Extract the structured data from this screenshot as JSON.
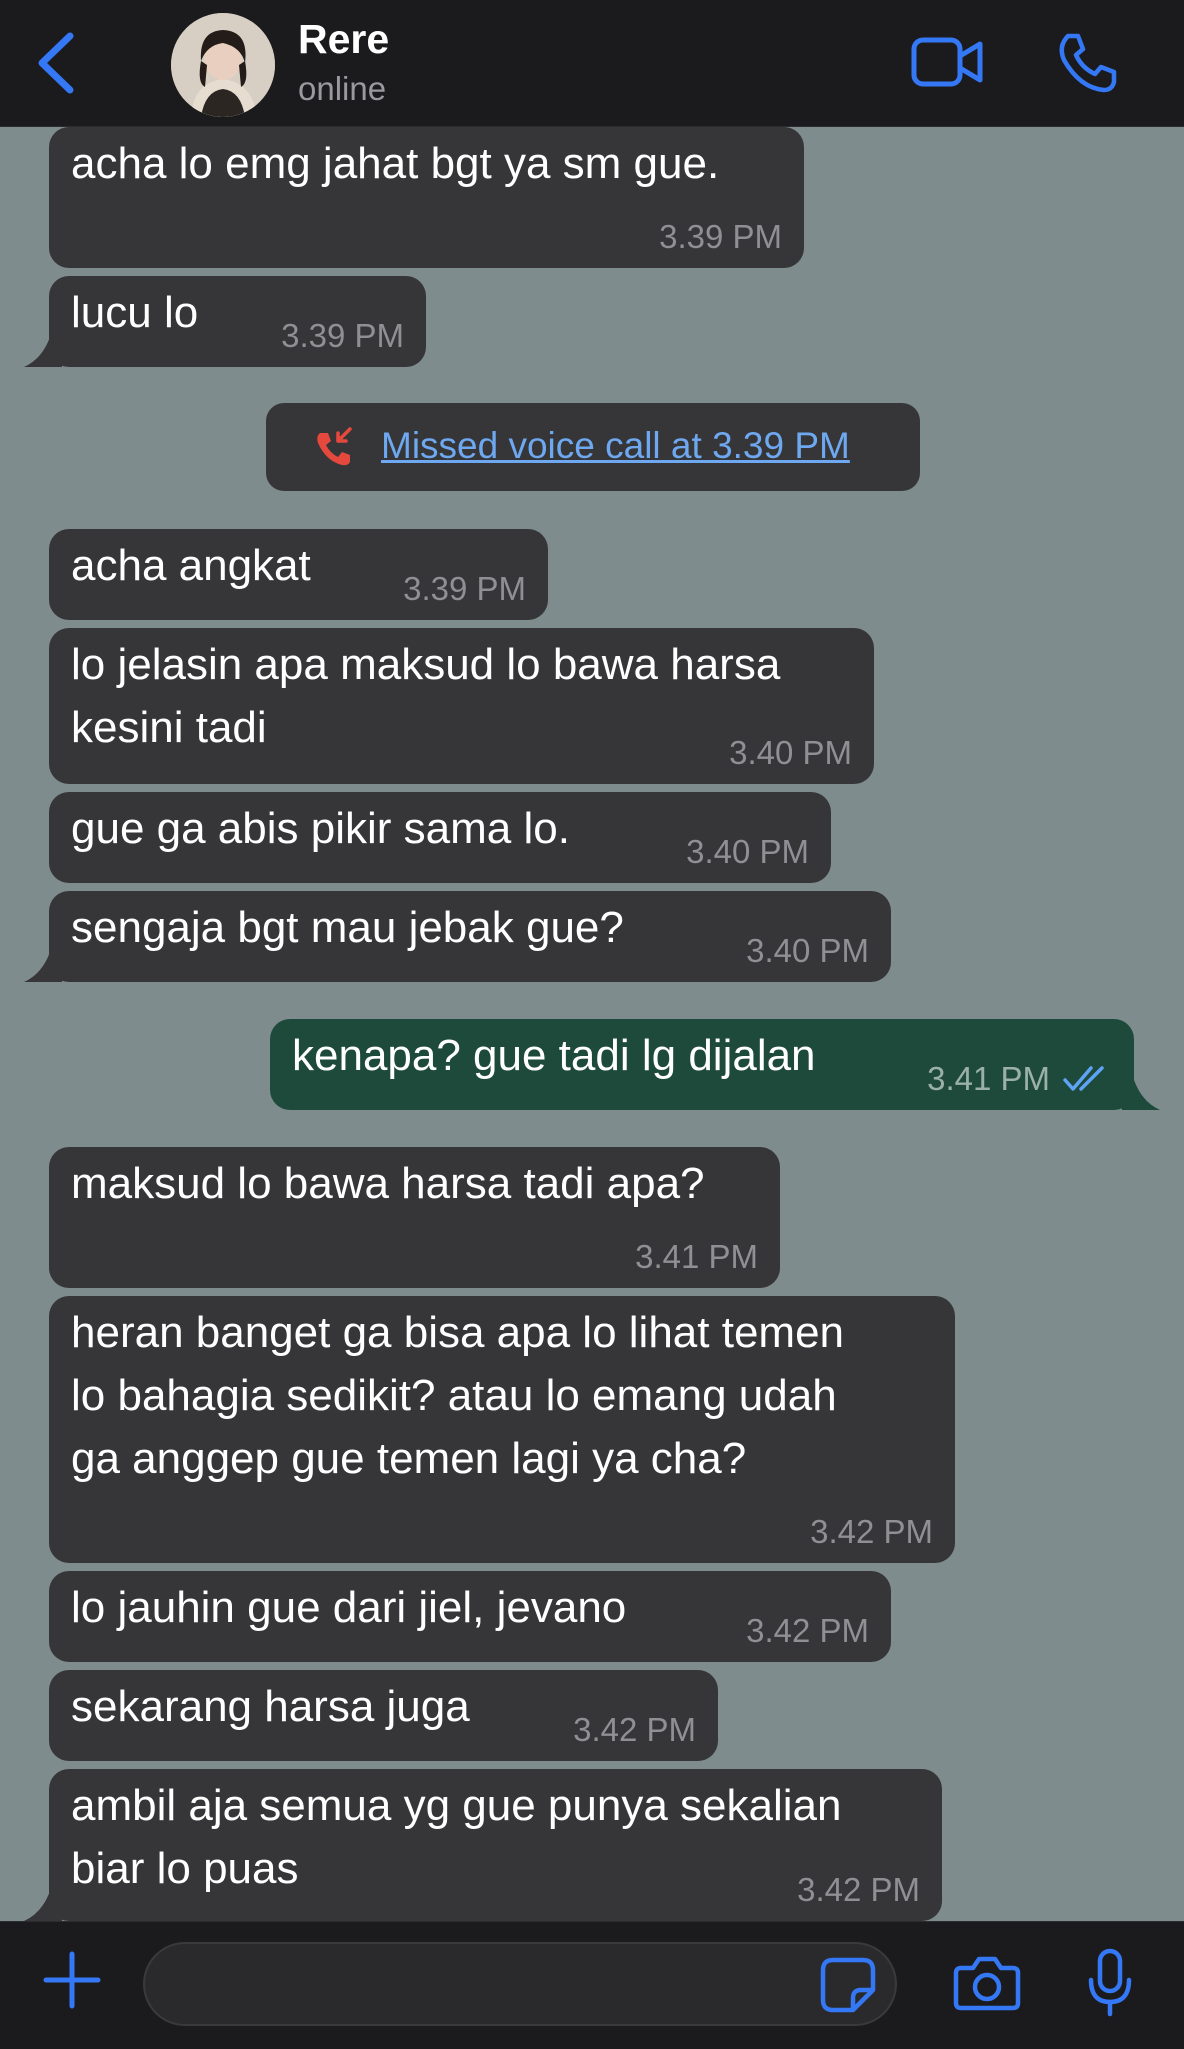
{
  "header": {
    "contact_name": "Rere",
    "status": "online",
    "icons": {
      "back": "chevron-left-icon",
      "video": "video-camera-icon",
      "call": "phone-icon"
    }
  },
  "colors": {
    "accent": "#3478f6",
    "chat_background": "#7f8c8e",
    "incoming_bubble": "#363638",
    "outgoing_bubble": "#1e4a3c",
    "missed_call": "#e5483d",
    "read_ticks": "#5fa3f5"
  },
  "messages": [
    {
      "text": "acha lo emg jahat bgt ya sm gue.",
      "time": "3.39 PM",
      "direction": "incoming"
    },
    {
      "text": "lucu lo",
      "time": "3.39 PM",
      "direction": "incoming"
    },
    {
      "text": "acha angkat",
      "time": "3.39 PM",
      "direction": "incoming"
    },
    {
      "text": "lo jelasin apa maksud lo bawa harsa\nkesini tadi",
      "time": "3.40 PM",
      "direction": "incoming"
    },
    {
      "text": "gue ga abis pikir sama lo.",
      "time": "3.40 PM",
      "direction": "incoming"
    },
    {
      "text": "sengaja bgt mau jebak gue?",
      "time": "3.40 PM",
      "direction": "incoming"
    },
    {
      "text": "kenapa? gue tadi lg dijalan",
      "time": "3.41 PM",
      "direction": "outgoing",
      "status": "read"
    },
    {
      "text": "maksud lo bawa harsa tadi apa?",
      "time": "3.41 PM",
      "direction": "incoming"
    },
    {
      "text": "heran banget ga bisa apa lo lihat temen\nlo bahagia sedikit? atau lo emang udah\nga anggep gue temen lagi ya cha?",
      "time": "3.42 PM",
      "direction": "incoming"
    },
    {
      "text": "lo jauhin gue dari jiel, jevano",
      "time": "3.42 PM",
      "direction": "incoming"
    },
    {
      "text": "sekarang harsa juga",
      "time": "3.42 PM",
      "direction": "incoming"
    },
    {
      "text": "ambil aja semua yg gue punya sekalian\nbiar lo puas",
      "time": "3.42 PM",
      "direction": "incoming"
    }
  ],
  "system_message": {
    "text": "Missed voice call at 3.39 PM",
    "icon": "missed-call-icon"
  },
  "input_bar": {
    "message_value": "",
    "icons": {
      "add": "plus-icon",
      "sticker": "sticker-icon",
      "camera": "camera-icon",
      "mic": "microphone-icon"
    }
  }
}
